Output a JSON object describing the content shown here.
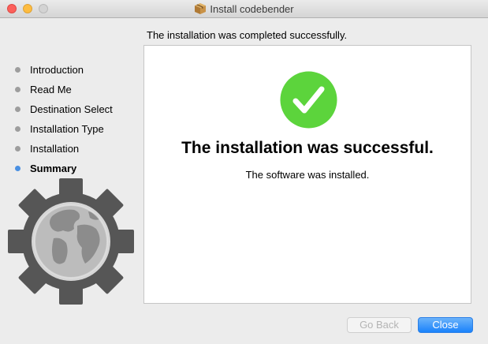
{
  "window": {
    "title": "Install codebender",
    "title_icon": "package-icon",
    "controls": [
      "close",
      "minimize",
      "zoom"
    ]
  },
  "header_message": "The installation was completed successfully.",
  "sidebar": {
    "steps": [
      {
        "label": "Introduction",
        "state": "done"
      },
      {
        "label": "Read Me",
        "state": "done"
      },
      {
        "label": "Destination Select",
        "state": "done"
      },
      {
        "label": "Installation Type",
        "state": "done"
      },
      {
        "label": "Installation",
        "state": "done"
      },
      {
        "label": "Summary",
        "state": "current"
      }
    ],
    "artwork": "installer-gear-globe-icon"
  },
  "content": {
    "icon": "success-check-icon",
    "title": "The installation was successful.",
    "subtitle": "The software was installed."
  },
  "buttons": {
    "back_label": "Go Back",
    "back_enabled": false,
    "close_label": "Close"
  },
  "colors": {
    "accent": "#1a82fb",
    "success": "#5cd43c",
    "current_step_dot": "#4a90e2",
    "step_dot": "#9d9d9d",
    "gear": "#565656",
    "globe": "#c9c9c9"
  }
}
